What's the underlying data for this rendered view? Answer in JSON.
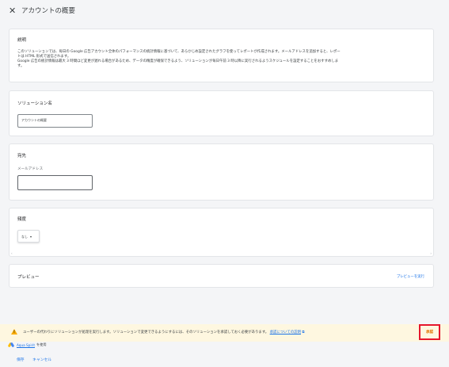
{
  "header": {
    "close_icon": "close-icon",
    "title": "アカウントの概要"
  },
  "description": {
    "label": "説明",
    "lines": [
      "このソリューションでは、毎日の Google 広告アカウント全体のパフォーマンスの統計情報に基づいて、あらかじめ設定されたグラフを使ってレポートが作成されます。メールアドレスを追加すると、レポー",
      "トは HTML 形式で送信されます。",
      "Google 広告の統計情報は最大 3 時間ほど変更が遅れる場合があるため、データの精度が確保できるよう、ソリューションが毎日午前 3 時以降に実行されるようスケジュールを設定することをおすすめしま",
      "す。"
    ]
  },
  "solution_name": {
    "label": "ソリューション名",
    "value": "アカウントの概要"
  },
  "recipients": {
    "label": "宛先",
    "email_label": "メールアドレス",
    "email_value": ""
  },
  "frequency": {
    "label": "頻度",
    "selected": "なし"
  },
  "preview": {
    "label": "プレビュー",
    "run_link": "プレビューを実行"
  },
  "warning": {
    "icon": "warning-icon",
    "text": "ユーザーの代わりにソリューションが処理を実行します。ソリューションで変更できるようにするには、そのソリューションを承認しておく必要があります。",
    "link": "承認についての説明",
    "approve_button": "承認"
  },
  "account": {
    "name": "Aqua Spirit",
    "suffix": "を使用"
  },
  "footer": {
    "save": "保存",
    "cancel": "キャンセル"
  },
  "colors": {
    "link": "#1a73e8",
    "warning_bg": "#fef7e0",
    "approve_highlight": "#e6172d",
    "approve_text": "#e37400"
  }
}
